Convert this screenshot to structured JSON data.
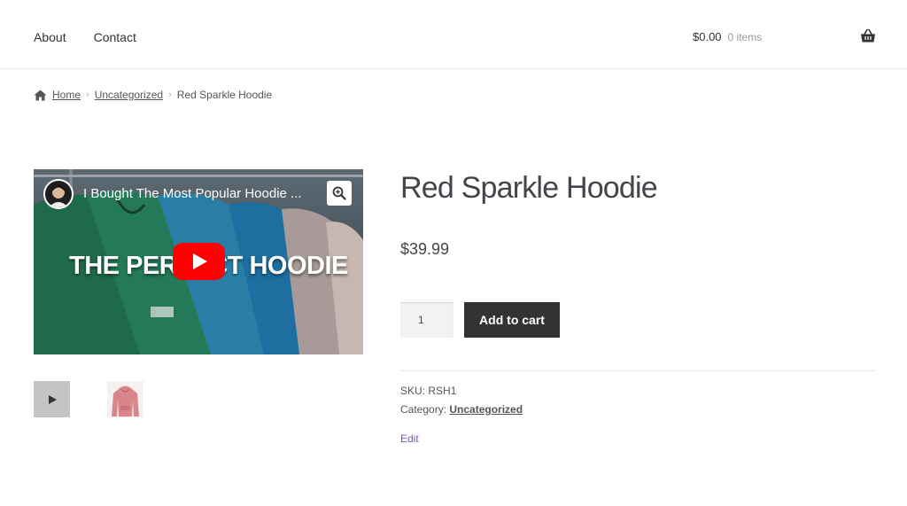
{
  "header": {
    "nav": [
      {
        "label": "About"
      },
      {
        "label": "Contact"
      }
    ],
    "cart": {
      "amount": "$0.00",
      "count": "0 items",
      "icon": "basket-icon"
    }
  },
  "breadcrumb": {
    "home": "Home",
    "category": "Uncategorized",
    "current": "Red Sparkle Hoodie",
    "separator": "›"
  },
  "gallery": {
    "video": {
      "title": "I Bought The Most Popular Hoodie ...",
      "overlay_text": "THE PERFECT HOODIE",
      "icons": {
        "play": "youtube-play-icon",
        "zoom": "zoom-in-icon"
      }
    },
    "thumbnails": [
      {
        "type": "video",
        "icon": "play-icon"
      },
      {
        "type": "image",
        "icon": "hoodie-image"
      }
    ]
  },
  "product": {
    "title": "Red Sparkle Hoodie",
    "price": "$39.99",
    "quantity": "1",
    "add_to_cart": "Add to cart",
    "sku_label": "SKU:",
    "sku": "RSH1",
    "category_label": "Category:",
    "category": "Uncategorized",
    "edit": "Edit"
  },
  "colors": {
    "text": "#43454b",
    "button_bg": "#333333",
    "link_edit": "#7f54b3",
    "youtube_red": "#ff0000"
  }
}
